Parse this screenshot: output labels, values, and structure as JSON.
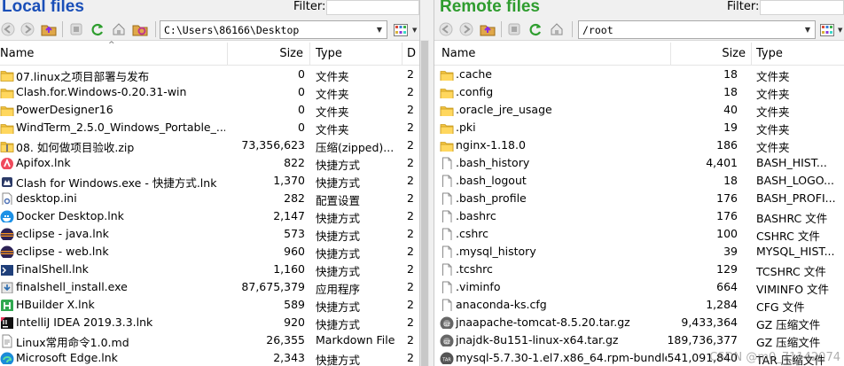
{
  "left": {
    "title": "Local files",
    "filter_label": "Filter:",
    "filter_value": "",
    "path": "C:\\Users\\86166\\Desktop",
    "columns": {
      "name": "Name",
      "size": "Size",
      "type": "Type",
      "date": "D"
    },
    "rows": [
      {
        "name": "07.linux之项目部署与发布",
        "size": "0",
        "type": "文件夹",
        "date": "2",
        "icon": "folder-icon"
      },
      {
        "name": "Clash.for.Windows-0.20.31-win",
        "size": "0",
        "type": "文件夹",
        "date": "2",
        "icon": "folder-icon"
      },
      {
        "name": "PowerDesigner16",
        "size": "0",
        "type": "文件夹",
        "date": "2",
        "icon": "folder-icon"
      },
      {
        "name": "WindTerm_2.5.0_Windows_Portable_...",
        "size": "0",
        "type": "文件夹",
        "date": "2",
        "icon": "folder-icon"
      },
      {
        "name": "08. 如何做项目验收.zip",
        "size": "73,356,623",
        "type": "压缩(zipped)...",
        "date": "2",
        "icon": "zip-folder-icon"
      },
      {
        "name": "Apifox.lnk",
        "size": "822",
        "type": "快捷方式",
        "date": "2",
        "icon": "apifox-icon"
      },
      {
        "name": "Clash for Windows.exe - 快捷方式.lnk",
        "size": "1,370",
        "type": "快捷方式",
        "date": "2",
        "icon": "clash-icon"
      },
      {
        "name": "desktop.ini",
        "size": "282",
        "type": "配置设置",
        "date": "2",
        "icon": "settings-file-icon"
      },
      {
        "name": "Docker Desktop.lnk",
        "size": "2,147",
        "type": "快捷方式",
        "date": "2",
        "icon": "docker-icon"
      },
      {
        "name": "eclipse - java.lnk",
        "size": "573",
        "type": "快捷方式",
        "date": "2",
        "icon": "eclipse-icon"
      },
      {
        "name": "eclipse - web.lnk",
        "size": "960",
        "type": "快捷方式",
        "date": "2",
        "icon": "eclipse-icon"
      },
      {
        "name": "FinalShell.lnk",
        "size": "1,160",
        "type": "快捷方式",
        "date": "2",
        "icon": "finalshell-icon"
      },
      {
        "name": "finalshell_install.exe",
        "size": "87,675,379",
        "type": "应用程序",
        "date": "2",
        "icon": "installer-icon"
      },
      {
        "name": "HBuilder X.lnk",
        "size": "589",
        "type": "快捷方式",
        "date": "2",
        "icon": "hbuilder-icon"
      },
      {
        "name": "IntelliJ IDEA 2019.3.3.lnk",
        "size": "920",
        "type": "快捷方式",
        "date": "2",
        "icon": "intellij-icon"
      },
      {
        "name": "Linux常用命令1.0.md",
        "size": "26,355",
        "type": "Markdown File",
        "date": "2",
        "icon": "document-icon"
      },
      {
        "name": "Microsoft Edge.lnk",
        "size": "2,343",
        "type": "快捷方式",
        "date": "2",
        "icon": "edge-icon"
      }
    ]
  },
  "right": {
    "title": "Remote files",
    "filter_label": "Filter:",
    "filter_value": "",
    "path": "/root",
    "columns": {
      "name": "Name",
      "size": "Size",
      "type": "Type"
    },
    "rows": [
      {
        "name": ".cache",
        "size": "18",
        "type": "文件夹",
        "icon": "folder-icon"
      },
      {
        "name": ".config",
        "size": "18",
        "type": "文件夹",
        "icon": "folder-icon"
      },
      {
        "name": ".oracle_jre_usage",
        "size": "40",
        "type": "文件夹",
        "icon": "folder-icon"
      },
      {
        "name": ".pki",
        "size": "19",
        "type": "文件夹",
        "icon": "folder-icon"
      },
      {
        "name": "nginx-1.18.0",
        "size": "186",
        "type": "文件夹",
        "icon": "folder-icon"
      },
      {
        "name": ".bash_history",
        "size": "4,401",
        "type": "BASH_HIST...",
        "icon": "file-icon"
      },
      {
        "name": ".bash_logout",
        "size": "18",
        "type": "BASH_LOGO...",
        "icon": "file-icon"
      },
      {
        "name": ".bash_profile",
        "size": "176",
        "type": "BASH_PROFI...",
        "icon": "file-icon"
      },
      {
        "name": ".bashrc",
        "size": "176",
        "type": "BASHRC 文件",
        "icon": "file-icon"
      },
      {
        "name": ".cshrc",
        "size": "100",
        "type": "CSHRC 文件",
        "icon": "file-icon"
      },
      {
        "name": ".mysql_history",
        "size": "39",
        "type": "MYSQL_HIST...",
        "icon": "file-icon"
      },
      {
        "name": ".tcshrc",
        "size": "129",
        "type": "TCSHRC 文件",
        "icon": "file-icon"
      },
      {
        "name": ".viminfo",
        "size": "664",
        "type": "VIMINFO 文件",
        "icon": "file-icon"
      },
      {
        "name": "anaconda-ks.cfg",
        "size": "1,284",
        "type": "CFG 文件",
        "icon": "file-icon"
      },
      {
        "name": "jnaapache-tomcat-8.5.20.tar.gz",
        "size": "9,433,364",
        "type": "GZ 压缩文件",
        "icon": "gz-archive-icon"
      },
      {
        "name": "jnajdk-8u151-linux-x64.tar.gz",
        "size": "189,736,377",
        "type": "GZ 压缩文件",
        "icon": "gz-archive-icon"
      },
      {
        "name": "mysql-5.7.30-1.el7.x86_64.rpm-bundle.t...",
        "size": "541,091,840",
        "type": "TAR 压缩文件",
        "icon": "tar-archive-icon"
      }
    ]
  },
  "watermark": "CSDN @m0_71142074",
  "colors": {
    "local_title": "#1a4fb8",
    "remote_title": "#2e9c2e",
    "folder": "#f5c542"
  }
}
